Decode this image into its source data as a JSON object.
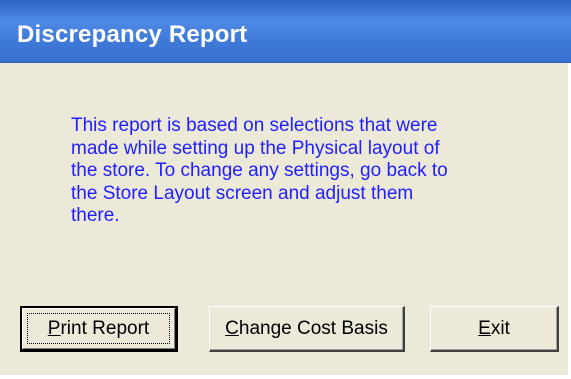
{
  "window": {
    "title": "Discrepancy Report"
  },
  "message": {
    "lines": [
      "This report is based on selections that were",
      "made while setting up the Physical layout of",
      "the store. To change any settings, go back to",
      "the Store Layout screen and adjust them",
      "there."
    ]
  },
  "buttons": {
    "print": {
      "mnemonic": "P",
      "rest": "rint Report"
    },
    "cost": {
      "mnemonic": "C",
      "rest": "hange Cost Basis"
    },
    "exit": {
      "mnemonic": "E",
      "rest": "xit"
    }
  },
  "colors": {
    "titlebar": "#3a70cf",
    "title_text": "#ffffff",
    "message_text": "#1f1fff",
    "dialog_face": "#ece9d8"
  }
}
